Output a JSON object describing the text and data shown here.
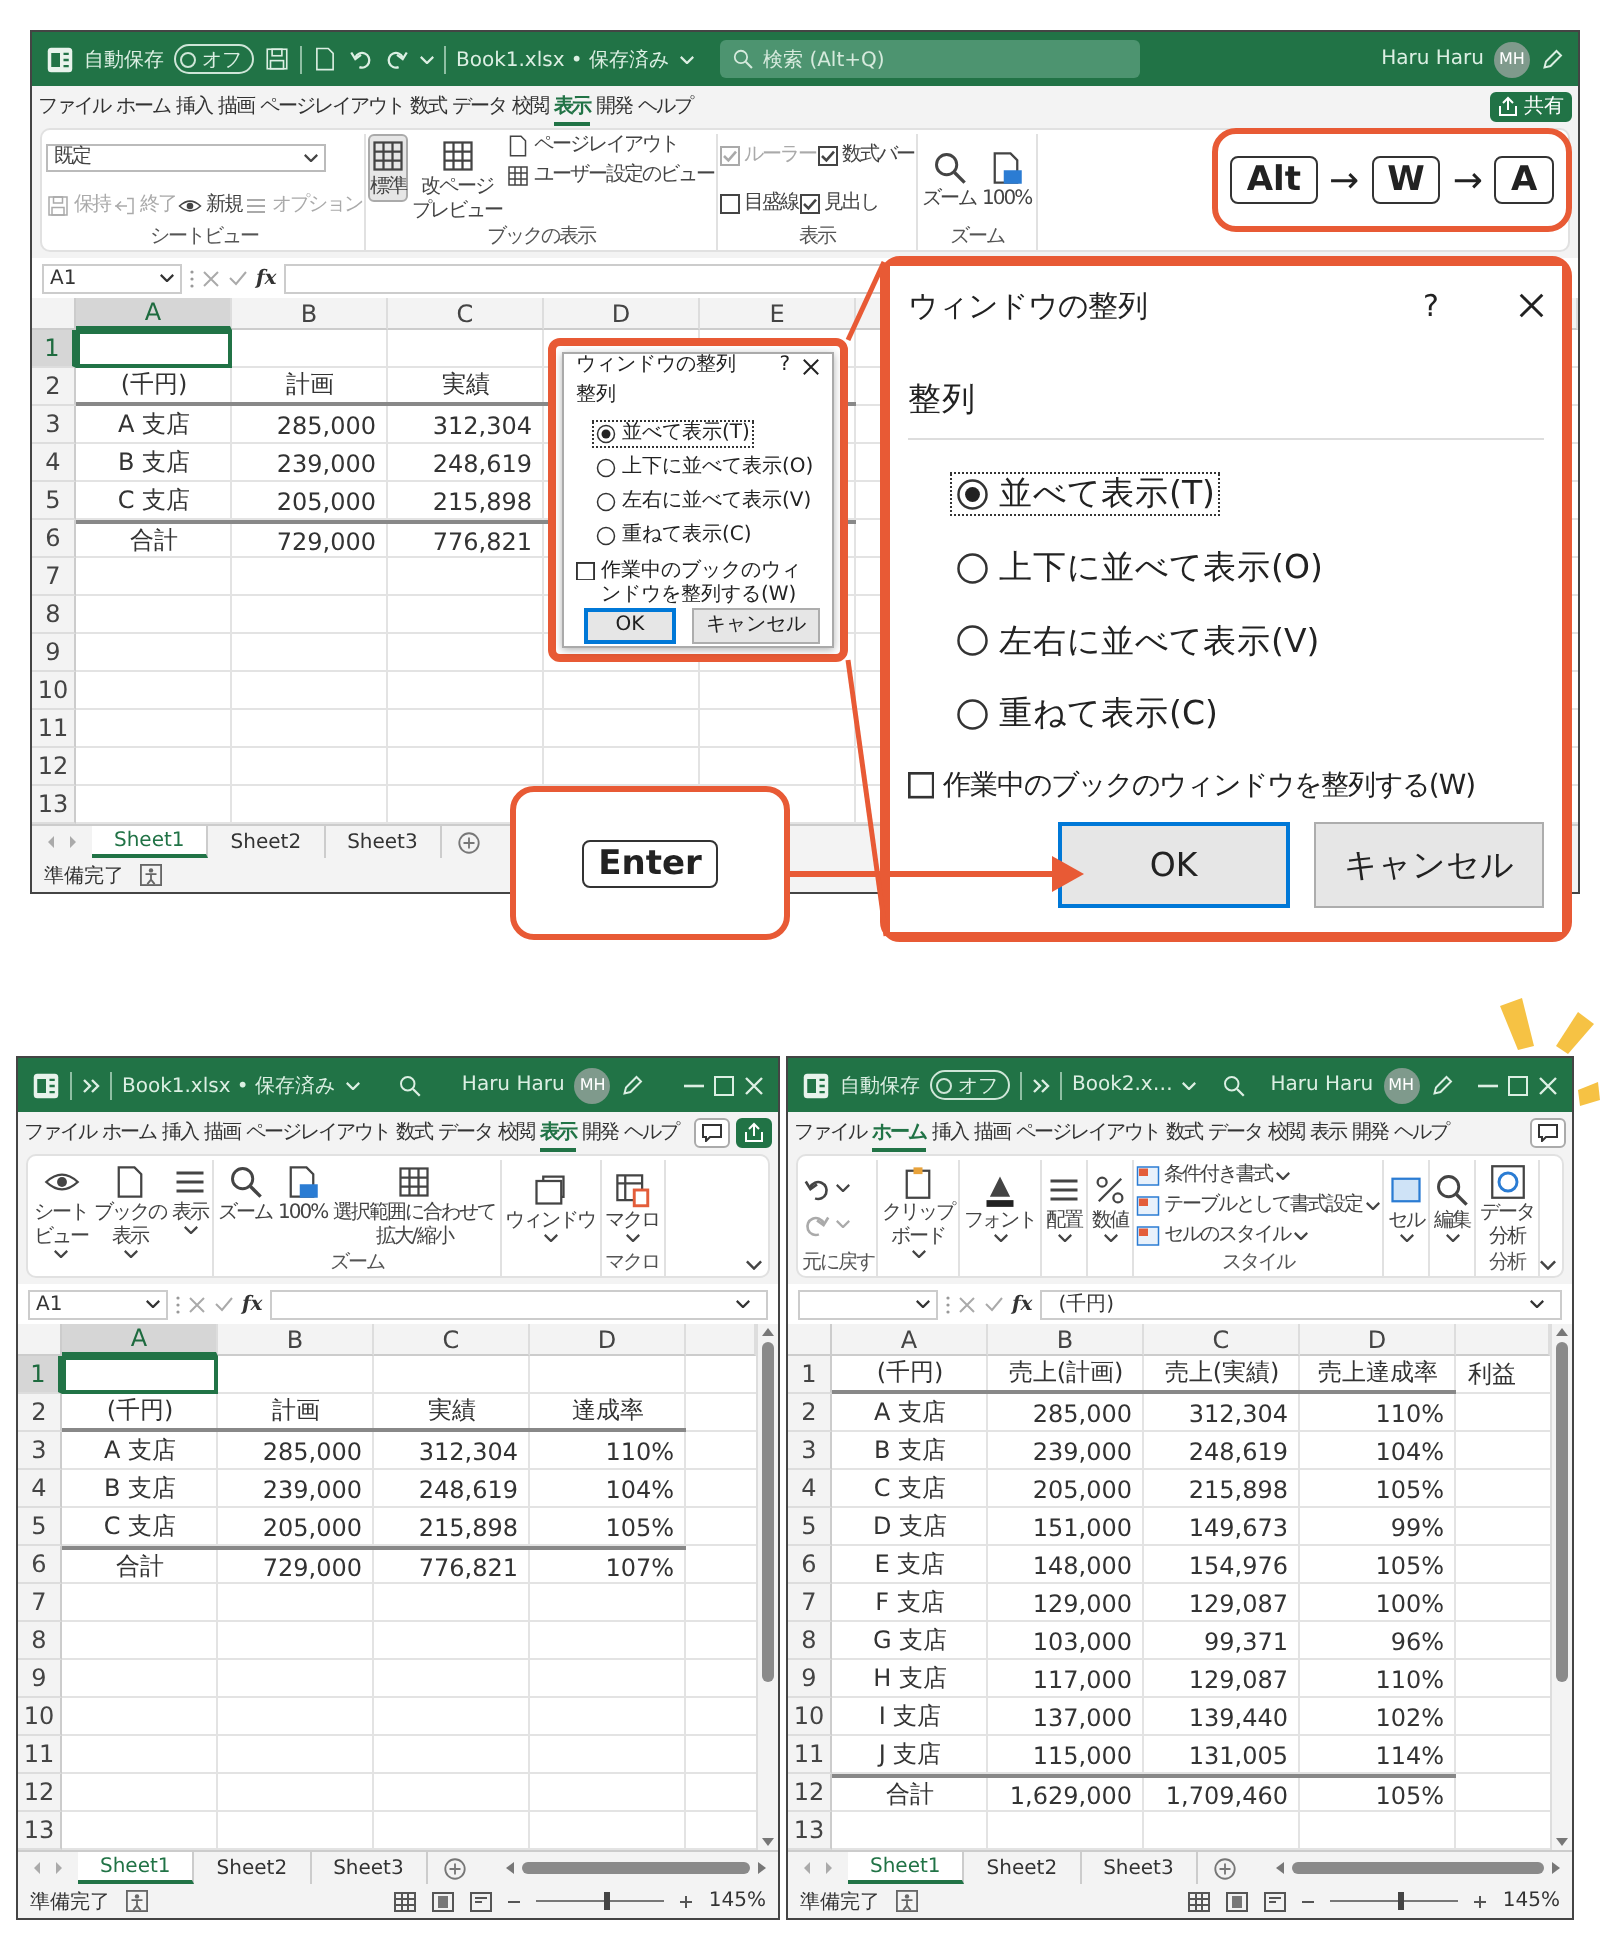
{
  "top_window": {
    "title_bar": {
      "autosave": {
        "label": "自動保存",
        "on": false,
        "toggle_label": "オフ"
      },
      "quick_access": {
        "kind": "full"
      },
      "file_name": "Book1.xlsx • 保存済み",
      "search": {
        "kind": "field",
        "placeholder": "検索 (Alt+Q)"
      },
      "user": "Haru Haru",
      "avatar": "MH"
    },
    "menu_tabs": [
      {
        "label": "ファイル",
        "selected": false
      },
      {
        "label": "ホーム",
        "selected": false
      },
      {
        "label": "挿入",
        "selected": false
      },
      {
        "label": "描画",
        "selected": false
      },
      {
        "label": "ページレイアウト",
        "selected": false
      },
      {
        "label": "数式",
        "selected": false
      },
      {
        "label": "データ",
        "selected": false
      },
      {
        "label": "校閲",
        "selected": false
      },
      {
        "label": "表示",
        "selected": true
      },
      {
        "label": "開発",
        "selected": false
      },
      {
        "label": "ヘルプ",
        "selected": false
      }
    ],
    "share": {
      "kind": "labeled",
      "label": "共有"
    },
    "ribbon": {
      "groups": [
        {
          "label": "シートビュー",
          "rows": [
            [
              {
                "kind": "dropdown",
                "label": "既定"
              }
            ],
            [
              {
                "kind": "small",
                "label": "保持",
                "disabled": true
              },
              {
                "kind": "small",
                "label": "終了",
                "disabled": true
              },
              {
                "kind": "small",
                "label": "新規",
                "disabled": false
              },
              {
                "kind": "small",
                "label": "オプション",
                "disabled": true
              }
            ]
          ]
        },
        {
          "label": "ブックの表示",
          "rows": [
            [
              {
                "kind": "large",
                "lines": [
                  "標準"
                ],
                "selected": true
              },
              {
                "kind": "large",
                "lines": [
                  "改ページ",
                  "プレビュー"
                ],
                "selected": false
              },
              {
                "kind": "stack",
                "items": [
                  {
                    "kind": "small",
                    "label": "ページレイアウト"
                  },
                  {
                    "kind": "small",
                    "label": "ユーザー設定のビュー"
                  }
                ]
              }
            ]
          ]
        },
        {
          "label": "表示",
          "rows": [
            [
              {
                "kind": "check",
                "label": "ルーラー",
                "checked": true,
                "disabled": true
              },
              {
                "kind": "check",
                "label": "数式バー",
                "checked": true,
                "disabled": false
              }
            ],
            [
              {
                "kind": "check",
                "label": "目盛線",
                "checked": false,
                "disabled": false
              },
              {
                "kind": "check",
                "label": "見出し",
                "checked": true,
                "disabled": false
              }
            ]
          ]
        },
        {
          "label": "ズーム",
          "rows": [
            [
              {
                "kind": "large",
                "lines": [
                  "ズーム"
                ]
              },
              {
                "kind": "large",
                "lines": [
                  "100%"
                ]
              }
            ]
          ]
        }
      ]
    },
    "formula_bar": {
      "name_box": "A1",
      "fx": "fx"
    },
    "columns": [
      {
        "label": "A",
        "selected": true
      },
      {
        "label": "B",
        "selected": false
      },
      {
        "label": "C",
        "selected": false
      },
      {
        "label": "D",
        "selected": false
      },
      {
        "label": "E",
        "selected": false
      }
    ],
    "rows": [
      {
        "header": "1",
        "selected": true,
        "kind": "data"
      },
      {
        "header": "2",
        "selected": false,
        "kind": "header",
        "cells": [
          "(千円)",
          "計画",
          "実績"
        ]
      },
      {
        "header": "3",
        "selected": false,
        "kind": "data",
        "cells": [
          "A 支店",
          "285,000",
          "312,304"
        ]
      },
      {
        "header": "4",
        "selected": false,
        "kind": "data",
        "cells": [
          "B 支店",
          "239,000",
          "248,619"
        ]
      },
      {
        "header": "5",
        "selected": false,
        "kind": "data",
        "cells": [
          "C 支店",
          "205,000",
          "215,898"
        ]
      },
      {
        "header": "6",
        "selected": false,
        "kind": "total",
        "cells": [
          "合計",
          "729,000",
          "776,821"
        ]
      },
      {
        "header": "7",
        "selected": false,
        "kind": "data"
      },
      {
        "header": "8",
        "selected": false,
        "kind": "data"
      },
      {
        "header": "9",
        "selected": false,
        "kind": "data"
      },
      {
        "header": "10",
        "selected": false,
        "kind": "data"
      },
      {
        "header": "11",
        "selected": false,
        "kind": "data"
      },
      {
        "header": "12",
        "selected": false,
        "kind": "data"
      },
      {
        "header": "13",
        "selected": false,
        "kind": "data"
      }
    ],
    "sheet_tabs": [
      {
        "label": "Sheet1",
        "selected": true
      },
      {
        "label": "Sheet2",
        "selected": false
      },
      {
        "label": "Sheet3",
        "selected": false
      }
    ],
    "status_bar": {
      "status": "準備完了"
    }
  },
  "dialog_thumbnail": {
    "title": "ウィンドウの整列",
    "help": "?",
    "group_label": "整列",
    "options": [
      {
        "label": "並べて表示(T)",
        "selected": true
      },
      {
        "label": "上下に並べて表示(O)",
        "selected": false
      },
      {
        "label": "左右に並べて表示(V)",
        "selected": false
      },
      {
        "label": "重ねて表示(C)",
        "selected": false
      }
    ],
    "checkbox": {
      "label": "作業中のブックのウィンドウを整列する(W)",
      "checked": false
    },
    "buttons": [
      {
        "label": "OK",
        "kind": "default"
      },
      {
        "label": "キャンセル",
        "kind": "normal"
      }
    ]
  },
  "shortcut_callout": {
    "sequence": [
      {
        "kind": "key",
        "label": "Alt"
      },
      {
        "kind": "arrow",
        "label": "→"
      },
      {
        "kind": "key",
        "label": "W"
      },
      {
        "kind": "arrow",
        "label": "→"
      },
      {
        "kind": "key",
        "label": "A"
      }
    ]
  },
  "dialog_zoomed": {
    "title": "ウィンドウの整列",
    "help": "?",
    "group_label": "整列",
    "options": [
      {
        "label": "並べて表示(T)",
        "selected": true
      },
      {
        "label": "上下に並べて表示(O)",
        "selected": false
      },
      {
        "label": "左右に並べて表示(V)",
        "selected": false
      },
      {
        "label": "重ねて表示(C)",
        "selected": false
      }
    ],
    "checkbox": {
      "label": "作業中のブックのウィンドウを整列する(W)",
      "checked": false
    },
    "buttons": [
      {
        "label": "OK",
        "kind": "default"
      },
      {
        "label": "キャンセル",
        "kind": "normal"
      }
    ]
  },
  "enter_callout": {
    "key": "Enter"
  },
  "bottom_windows": [
    {
      "title_bar": {
        "quick_access": {
          "kind": "compact"
        },
        "file_name": "Book1.xlsx • 保存済み",
        "search": {
          "kind": "icon"
        },
        "user": "Haru Haru",
        "avatar": "MH",
        "window_controls": true
      },
      "menu_tabs": [
        {
          "label": "ファイル",
          "selected": false
        },
        {
          "label": "ホーム",
          "selected": false
        },
        {
          "label": "挿入",
          "selected": false
        },
        {
          "label": "描画",
          "selected": false
        },
        {
          "label": "ページレイアウト",
          "selected": false
        },
        {
          "label": "数式",
          "selected": false
        },
        {
          "label": "データ",
          "selected": false
        },
        {
          "label": "校閲",
          "selected": false
        },
        {
          "label": "表示",
          "selected": true
        },
        {
          "label": "開発",
          "selected": false
        },
        {
          "label": "ヘルプ",
          "selected": false
        }
      ],
      "comment_button": true,
      "share": {
        "kind": "icon"
      },
      "ribbon": {
        "collapse_button": true,
        "groups": [
          {
            "rows": [
              [
                {
                  "kind": "large",
                  "lines": [
                    "シート",
                    "ビュー"
                  ],
                  "caret": true
                },
                {
                  "kind": "large",
                  "lines": [
                    "ブックの",
                    "表示"
                  ],
                  "caret": true
                },
                {
                  "kind": "large",
                  "lines": [
                    "表示"
                  ],
                  "caret": true
                }
              ]
            ]
          },
          {
            "label": "ズーム",
            "rows": [
              [
                {
                  "kind": "large",
                  "lines": [
                    "ズーム"
                  ]
                },
                {
                  "kind": "large",
                  "lines": [
                    "100%"
                  ]
                },
                {
                  "kind": "large",
                  "lines": [
                    "選択範囲に合わせて",
                    "拡大/縮小"
                  ]
                }
              ]
            ]
          },
          {
            "rows": [
              [
                {
                  "kind": "large",
                  "lines": [
                    "ウィンドウ"
                  ],
                  "caret": true
                }
              ]
            ]
          },
          {
            "label": "マクロ",
            "rows": [
              [
                {
                  "kind": "large",
                  "lines": [
                    "マクロ"
                  ],
                  "caret": true
                }
              ]
            ]
          }
        ]
      },
      "formula_bar": {
        "name_box": "A1",
        "fx": "fx",
        "expand_button": true
      },
      "columns": [
        {
          "label": "A",
          "selected": true
        },
        {
          "label": "B",
          "selected": false
        },
        {
          "label": "C",
          "selected": false
        },
        {
          "label": "D",
          "selected": false
        }
      ],
      "rows": [
        {
          "header": "1",
          "selected": true,
          "kind": "data"
        },
        {
          "header": "2",
          "selected": false,
          "kind": "header",
          "cells": [
            "(千円)",
            "計画",
            "実績",
            "達成率"
          ]
        },
        {
          "header": "3",
          "selected": false,
          "kind": "data",
          "cells": [
            "A 支店",
            "285,000",
            "312,304",
            "110%"
          ]
        },
        {
          "header": "4",
          "selected": false,
          "kind": "data",
          "cells": [
            "B 支店",
            "239,000",
            "248,619",
            "104%"
          ]
        },
        {
          "header": "5",
          "selected": false,
          "kind": "data",
          "cells": [
            "C 支店",
            "205,000",
            "215,898",
            "105%"
          ]
        },
        {
          "header": "6",
          "selected": false,
          "kind": "total",
          "cells": [
            "合計",
            "729,000",
            "776,821",
            "107%"
          ]
        },
        {
          "header": "7",
          "selected": false,
          "kind": "data"
        },
        {
          "header": "8",
          "selected": false,
          "kind": "data"
        },
        {
          "header": "9",
          "selected": false,
          "kind": "data"
        },
        {
          "header": "10",
          "selected": false,
          "kind": "data"
        },
        {
          "header": "11",
          "selected": false,
          "kind": "data"
        },
        {
          "header": "12",
          "selected": false,
          "kind": "data"
        },
        {
          "header": "13",
          "selected": false,
          "kind": "data"
        }
      ],
      "v_scrollbar": true,
      "h_scrollbar": true,
      "sheet_tabs": [
        {
          "label": "Sheet1",
          "selected": true
        },
        {
          "label": "Sheet2",
          "selected": false
        },
        {
          "label": "Sheet3",
          "selected": false
        }
      ],
      "status_bar": {
        "status": "準備完了",
        "zoom": {
          "level": 0.55,
          "reading": "145%"
        }
      }
    },
    {
      "title_bar": {
        "autosave": {
          "label": "自動保存",
          "on": false,
          "toggle_label": "オフ"
        },
        "quick_access": {
          "kind": "compact"
        },
        "file_name": "Book2.x…",
        "search": {
          "kind": "icon"
        },
        "user": "Haru Haru",
        "avatar": "MH",
        "window_controls": true
      },
      "menu_tabs": [
        {
          "label": "ファイル",
          "selected": false
        },
        {
          "label": "ホーム",
          "selected": true
        },
        {
          "label": "挿入",
          "selected": false
        },
        {
          "label": "描画",
          "selected": false
        },
        {
          "label": "ページレイアウト",
          "selected": false
        },
        {
          "label": "数式",
          "selected": false
        },
        {
          "label": "データ",
          "selected": false
        },
        {
          "label": "校閲",
          "selected": false
        },
        {
          "label": "表示",
          "selected": false
        },
        {
          "label": "開発",
          "selected": false
        },
        {
          "label": "ヘルプ",
          "selected": false
        }
      ],
      "comment_button": true,
      "ribbon": {
        "collapse_button": true,
        "groups": [
          {
            "label": "元に戻す",
            "rows": [
              [
                {
                  "kind": "stack",
                  "items": [
                    {
                      "kind": "iconbtn",
                      "caret": true,
                      "disabled": false
                    },
                    {
                      "kind": "iconbtn",
                      "caret": true,
                      "disabled": true
                    }
                  ]
                }
              ]
            ]
          },
          {
            "rows": [
              [
                {
                  "kind": "large",
                  "lines": [
                    "クリップ",
                    "ボード"
                  ],
                  "caret": true
                }
              ]
            ]
          },
          {
            "rows": [
              [
                {
                  "kind": "large",
                  "lines": [
                    "フォント"
                  ],
                  "caret": true
                }
              ]
            ]
          },
          {
            "rows": [
              [
                {
                  "kind": "large",
                  "lines": [
                    "配置"
                  ],
                  "caret": true
                }
              ]
            ]
          },
          {
            "rows": [
              [
                {
                  "kind": "large",
                  "lines": [
                    "数値"
                  ],
                  "caret": true
                }
              ]
            ]
          },
          {
            "label": "スタイル",
            "rows": [
              [
                {
                  "kind": "stack",
                  "items": [
                    {
                      "kind": "small",
                      "label": "条件付き書式",
                      "caret": true
                    },
                    {
                      "kind": "small",
                      "label": "テーブルとして書式設定",
                      "caret": true
                    },
                    {
                      "kind": "small",
                      "label": "セルのスタイル",
                      "caret": true
                    }
                  ]
                }
              ]
            ]
          },
          {
            "rows": [
              [
                {
                  "kind": "large",
                  "lines": [
                    "セル"
                  ],
                  "caret": true
                }
              ]
            ]
          },
          {
            "rows": [
              [
                {
                  "kind": "large",
                  "lines": [
                    "編集"
                  ],
                  "caret": true
                }
              ]
            ]
          },
          {
            "label": "分析",
            "rows": [
              [
                {
                  "kind": "large",
                  "lines": [
                    "データ",
                    "分析"
                  ]
                }
              ]
            ]
          }
        ]
      },
      "formula_bar": {
        "fx": "fx",
        "formula": "(千円)",
        "expand_button": true
      },
      "columns": [
        {
          "label": "A",
          "selected": false
        },
        {
          "label": "B",
          "selected": false
        },
        {
          "label": "C",
          "selected": false
        },
        {
          "label": "D",
          "selected": false
        }
      ],
      "rows": [
        {
          "header": "1",
          "selected": false,
          "kind": "header",
          "cells": [
            "(千円)",
            "売上(計画)",
            "売上(実績)",
            "売上達成率",
            "利益"
          ]
        },
        {
          "header": "2",
          "selected": false,
          "kind": "data",
          "cells": [
            "A 支店",
            "285,000",
            "312,304",
            "110%"
          ]
        },
        {
          "header": "3",
          "selected": false,
          "kind": "data",
          "cells": [
            "B 支店",
            "239,000",
            "248,619",
            "104%"
          ]
        },
        {
          "header": "4",
          "selected": false,
          "kind": "data",
          "cells": [
            "C 支店",
            "205,000",
            "215,898",
            "105%"
          ]
        },
        {
          "header": "5",
          "selected": false,
          "kind": "data",
          "cells": [
            "D 支店",
            "151,000",
            "149,673",
            "99%"
          ]
        },
        {
          "header": "6",
          "selected": false,
          "kind": "data",
          "cells": [
            "E 支店",
            "148,000",
            "154,976",
            "105%"
          ]
        },
        {
          "header": "7",
          "selected": false,
          "kind": "data",
          "cells": [
            "F 支店",
            "129,000",
            "129,087",
            "100%"
          ]
        },
        {
          "header": "8",
          "selected": false,
          "kind": "data",
          "cells": [
            "G 支店",
            "103,000",
            "99,371",
            "96%"
          ]
        },
        {
          "header": "9",
          "selected": false,
          "kind": "data",
          "cells": [
            "H 支店",
            "117,000",
            "129,087",
            "110%"
          ]
        },
        {
          "header": "10",
          "selected": false,
          "kind": "data",
          "cells": [
            "I 支店",
            "137,000",
            "139,440",
            "102%"
          ]
        },
        {
          "header": "11",
          "selected": false,
          "kind": "data",
          "cells": [
            "J 支店",
            "115,000",
            "131,005",
            "114%"
          ]
        },
        {
          "header": "12",
          "selected": false,
          "kind": "total",
          "cells": [
            "合計",
            "1,629,000",
            "1,709,460",
            "105%"
          ]
        },
        {
          "header": "13",
          "selected": false,
          "kind": "data"
        }
      ],
      "v_scrollbar": true,
      "h_scrollbar": true,
      "sheet_tabs": [
        {
          "label": "Sheet1",
          "selected": true
        },
        {
          "label": "Sheet2",
          "selected": false
        },
        {
          "label": "Sheet3",
          "selected": false
        }
      ],
      "status_bar": {
        "status": "準備完了",
        "zoom": {
          "level": 0.55,
          "reading": "145%"
        }
      }
    }
  ]
}
